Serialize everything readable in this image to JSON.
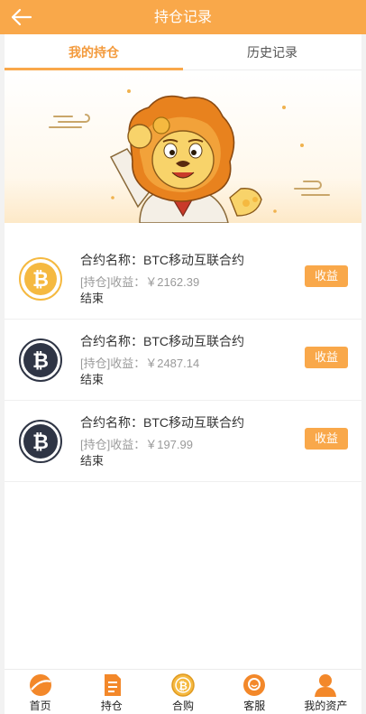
{
  "header": {
    "title": "持仓记录",
    "back_icon": "arrow-left-icon"
  },
  "tabs": [
    {
      "label": "我的持仓",
      "active": true
    },
    {
      "label": "历史记录",
      "active": false
    }
  ],
  "positions": [
    {
      "name": "合约名称：BTC移动互联合约",
      "profit": "[持仓]收益：￥2162.39",
      "status": "结束",
      "button": "收益",
      "icon": "bitcoin-gold-icon"
    },
    {
      "name": "合约名称：BTC移动互联合约",
      "profit": "[持仓]收益：￥2487.14",
      "status": "结束",
      "button": "收益",
      "icon": "bitcoin-dark-icon"
    },
    {
      "name": "合约名称：BTC移动互联合约",
      "profit": "[持仓]收益：￥197.99",
      "status": "结束",
      "button": "收益",
      "icon": "bitcoin-dark-icon"
    }
  ],
  "tabbar": [
    {
      "label": "首页",
      "icon": "home-icon"
    },
    {
      "label": "持仓",
      "icon": "document-icon"
    },
    {
      "label": "合购",
      "icon": "coin-icon"
    },
    {
      "label": "客服",
      "icon": "chat-icon"
    },
    {
      "label": "我的资产",
      "icon": "user-icon"
    }
  ],
  "colors": {
    "accent": "#f9a84a",
    "gold": "#f5b940",
    "dark_coin": "#2f3545"
  }
}
